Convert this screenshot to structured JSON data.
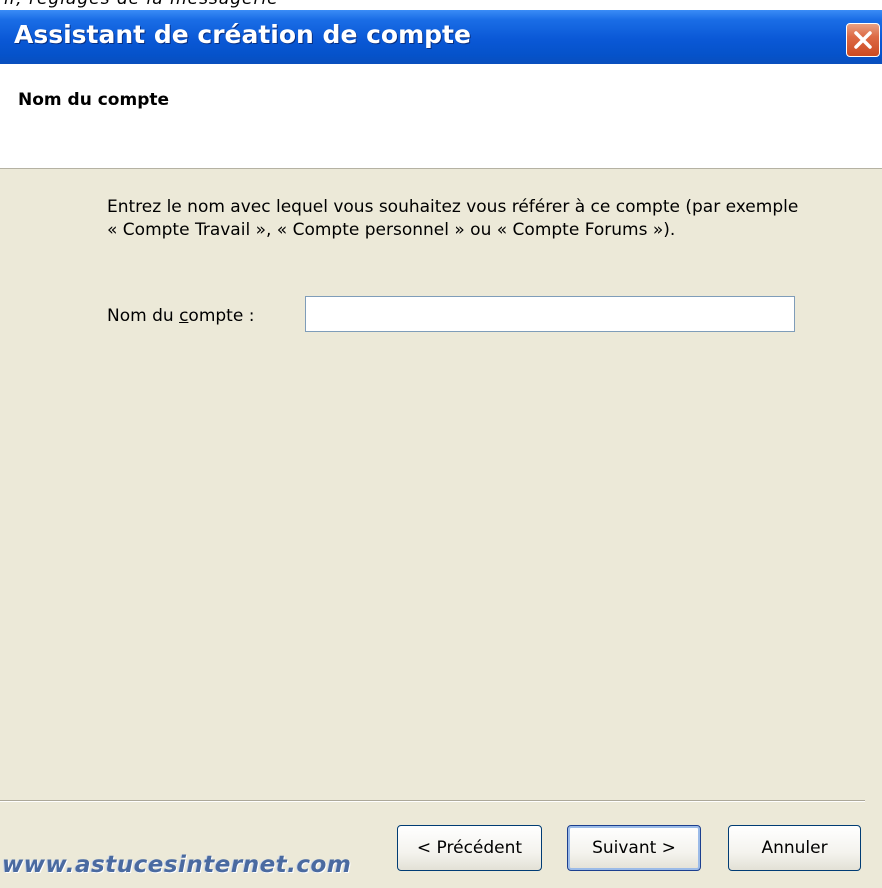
{
  "top_strip_text": "ir, réglages de la messagerie",
  "window": {
    "title": "Assistant de création de compte",
    "close_icon": "close-icon"
  },
  "header": {
    "heading": "Nom du compte"
  },
  "content": {
    "description": "Entrez le nom avec lequel vous souhaitez vous référer à ce compte (par exemple « Compte Travail », « Compte personnel » ou « Compte Forums »).",
    "field_label_prefix": "Nom du ",
    "field_label_accel": "c",
    "field_label_suffix": "ompte :",
    "account_name_value": ""
  },
  "buttons": {
    "previous": "< Précédent",
    "next": "Suivant >",
    "cancel": "Annuler"
  },
  "watermark": "www.astucesinternet.com"
}
